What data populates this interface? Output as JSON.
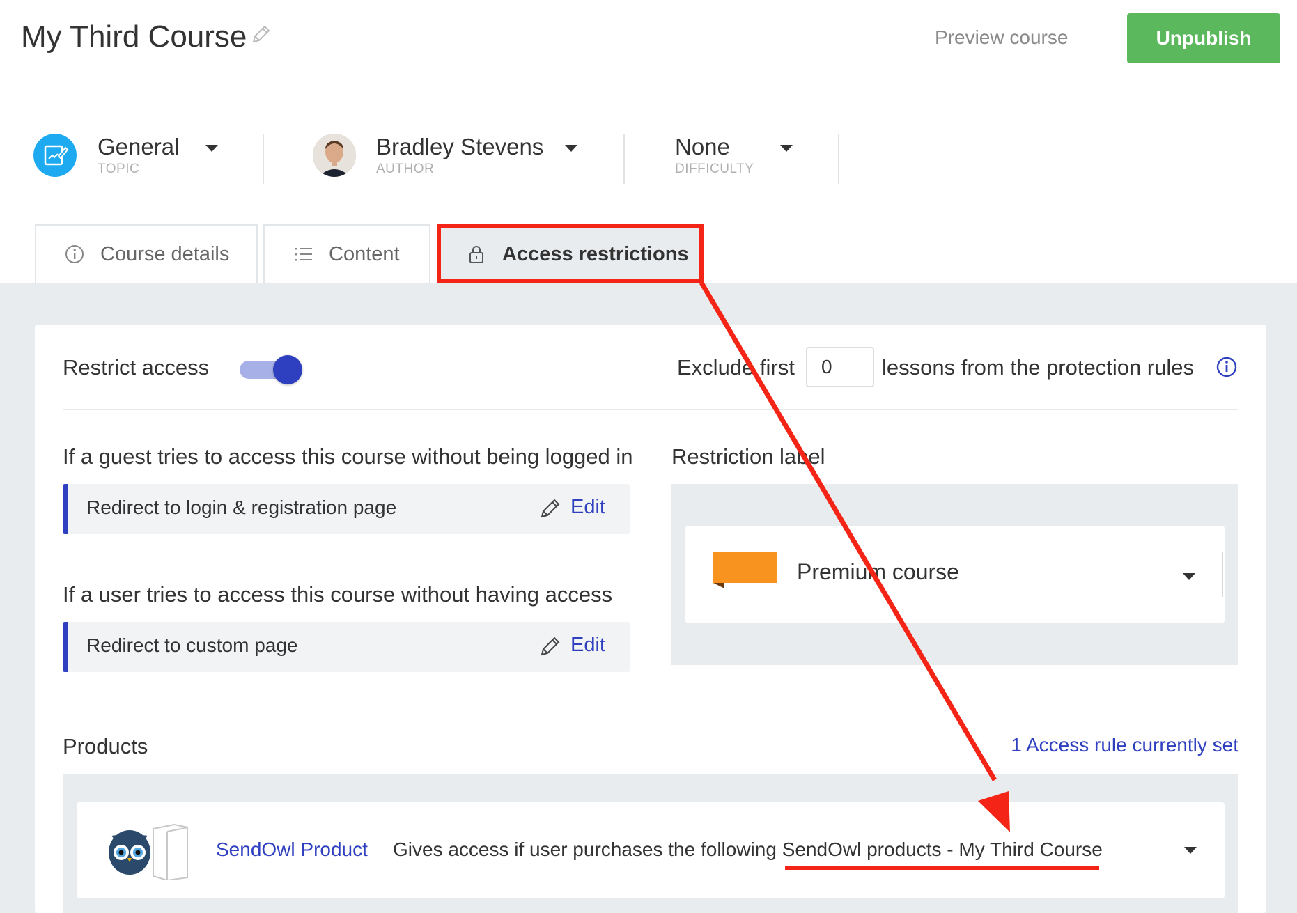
{
  "header": {
    "title": "My Third Course",
    "preview_label": "Preview course",
    "unpublish_label": "Unpublish"
  },
  "meta": {
    "topic": {
      "value": "General",
      "label": "TOPIC"
    },
    "author": {
      "value": "Bradley Stevens",
      "label": "AUTHOR"
    },
    "difficulty": {
      "value": "None",
      "label": "DIFFICULTY"
    }
  },
  "tabs": [
    {
      "label": "Course details",
      "icon": "info-icon"
    },
    {
      "label": "Content",
      "icon": "list-icon"
    },
    {
      "label": "Access restrictions",
      "icon": "lock-icon",
      "active": true
    }
  ],
  "restrict": {
    "label": "Restrict access",
    "enabled": true,
    "exclude_prefix": "Exclude first",
    "exclude_value": "0",
    "exclude_suffix": "lessons from the protection rules"
  },
  "guest_rule": {
    "heading": "If a guest tries to access this course without being logged in",
    "value": "Redirect to login & registration page",
    "edit_label": "Edit"
  },
  "user_rule": {
    "heading": "If a user tries to access this course without having access",
    "value": "Redirect to custom page",
    "edit_label": "Edit"
  },
  "restriction_label": {
    "heading": "Restriction label",
    "selected": "Premium course",
    "ribbon_color": "#f7931e"
  },
  "products": {
    "heading": "Products",
    "access_rule_link": "1 Access rule currently set",
    "items": [
      {
        "name": "SendOwl Product",
        "description": "Gives access if user purchases the following SendOwl products - My Third Course"
      }
    ]
  },
  "colors": {
    "accent": "#2e3fbf",
    "success": "#5cb85c",
    "annotation": "#f42516",
    "topic_icon": "#1eaaf1"
  }
}
